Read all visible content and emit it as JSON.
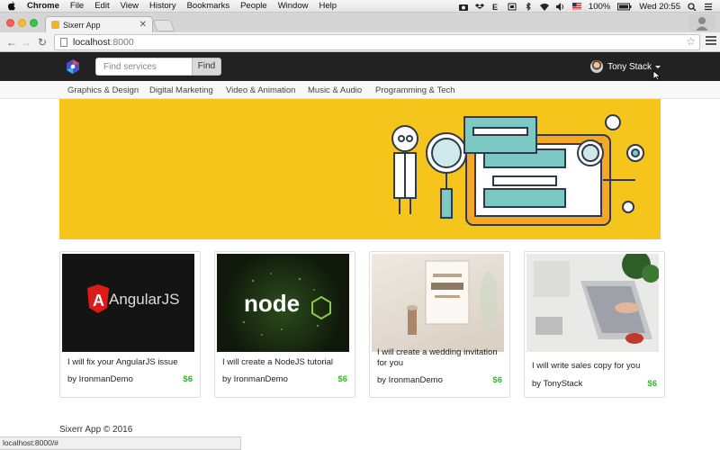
{
  "menubar": {
    "app_name": "Chrome",
    "items": [
      "File",
      "Edit",
      "View",
      "History",
      "Bookmarks",
      "People",
      "Window",
      "Help"
    ],
    "battery": "100%",
    "clock": "Wed 20:55"
  },
  "browser": {
    "tab_title": "Sixerr App",
    "url_host": "localhost",
    "url_port": ":8000",
    "status_url": "localhost:8000/#"
  },
  "app": {
    "search_placeholder": "Find services",
    "find_label": "Find",
    "user_name": "Tony Stack",
    "categories": [
      "Graphics & Design",
      "Digital Marketing",
      "Video & Animation",
      "Music & Audio",
      "Programming & Tech"
    ],
    "accent": "#2eb82e",
    "hero_color": "#f5c51c"
  },
  "gigs": [
    {
      "image": "angularjs-logo",
      "image_text": "AngularJS",
      "title": "I will fix your AngularJS issue",
      "seller": "by IronmanDemo",
      "price": "$6"
    },
    {
      "image": "nodejs-logo",
      "image_text": "node",
      "title": "I will create a NodeJS tutorial",
      "seller": "by IronmanDemo",
      "price": "$6"
    },
    {
      "image": "wedding-invitation-photo",
      "title": "I will create a wedding invitation for you",
      "seller": "by IronmanDemo",
      "price": "$6"
    },
    {
      "image": "laptop-desk-photo",
      "title": "I will write sales copy for you",
      "seller": "by TonyStack",
      "price": "$6"
    }
  ],
  "footer": {
    "copyright": "Sixerr App © 2016"
  }
}
